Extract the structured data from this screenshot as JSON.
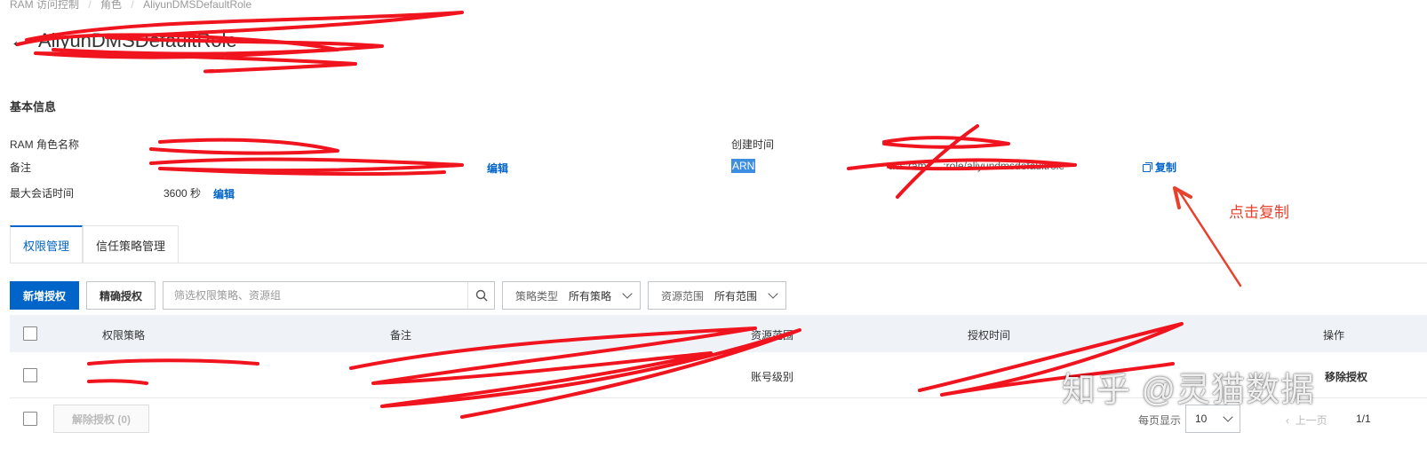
{
  "breadcrumb": {
    "items": [
      "RAM 访问控制",
      "角色",
      "AliyunDMSDefaultRole"
    ],
    "separator": "/"
  },
  "header": {
    "title": "AliyunDMSDefaultRole"
  },
  "basic_info": {
    "section_title": "基本信息",
    "role_name_label": "RAM 角色名称",
    "remark_label": "备注",
    "remark_edit": "编辑",
    "max_session_label": "最大会话时间",
    "max_session_value": "3600 秒",
    "max_session_edit": "编辑",
    "create_time_label": "创建时间",
    "arn_label": "ARN",
    "arn_value": "acs:ram::…:role/aliyundmsdefaultrole",
    "copy_label": "复制"
  },
  "tabs": [
    {
      "label": "权限管理",
      "active": true
    },
    {
      "label": "信任策略管理",
      "active": false
    }
  ],
  "toolbar": {
    "add_button": "新增授权",
    "precise_button": "精确授权",
    "search_placeholder": "筛选权限策略、资源组",
    "policy_type_label": "策略类型",
    "policy_type_value": "所有策略",
    "resource_scope_label": "资源范围",
    "resource_scope_value": "所有范围"
  },
  "table": {
    "headers": [
      "权限策略",
      "备注",
      "资源范围",
      "授权时间",
      "操作"
    ],
    "rows": [
      {
        "scope": "账号级别",
        "action": "移除授权"
      }
    ]
  },
  "footer": {
    "remove_button": "解除授权 (0)",
    "page_size_label": "每页显示",
    "page_size_value": "10",
    "prev_label": "上一页",
    "page_count": "1/1"
  },
  "annotation": {
    "text": "点击复制",
    "color": "#e8402c"
  },
  "watermark": {
    "text": "知乎 @灵猫数据"
  },
  "colors": {
    "primary": "#0064c8",
    "header_bg": "#eff3f8",
    "scribble": "#f0141e"
  }
}
